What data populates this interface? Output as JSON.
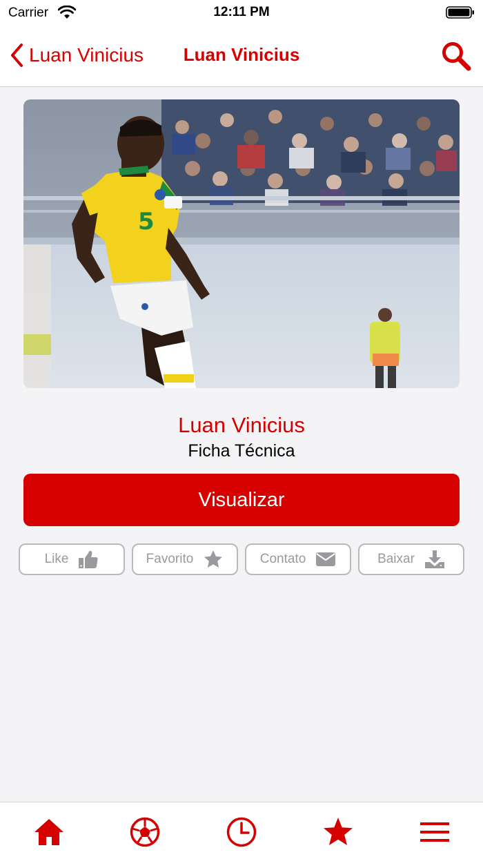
{
  "status_bar": {
    "carrier": "Carrier",
    "time": "12:11 PM"
  },
  "nav": {
    "back_label": "Luan Vinicius",
    "title": "Luan Vinicius",
    "search_icon": "search-icon"
  },
  "player": {
    "name": "Luan Vinicius",
    "subtitle": "Ficha Técnica",
    "jersey_number": "5"
  },
  "primary_action": {
    "label": "Visualizar"
  },
  "actions": [
    {
      "label": "Like",
      "icon": "thumbs-up-icon"
    },
    {
      "label": "Favorito",
      "icon": "star-icon"
    },
    {
      "label": "Contato",
      "icon": "envelope-icon"
    },
    {
      "label": "Baixar",
      "icon": "download-icon"
    }
  ],
  "tabs": [
    {
      "icon": "home-icon"
    },
    {
      "icon": "soccer-ball-icon"
    },
    {
      "icon": "clock-icon"
    },
    {
      "icon": "star-icon"
    },
    {
      "icon": "menu-icon"
    }
  ],
  "colors": {
    "accent": "#d50000",
    "button": "#d70000",
    "action_text": "#9a9a9e",
    "background": "#f4f4f6"
  }
}
